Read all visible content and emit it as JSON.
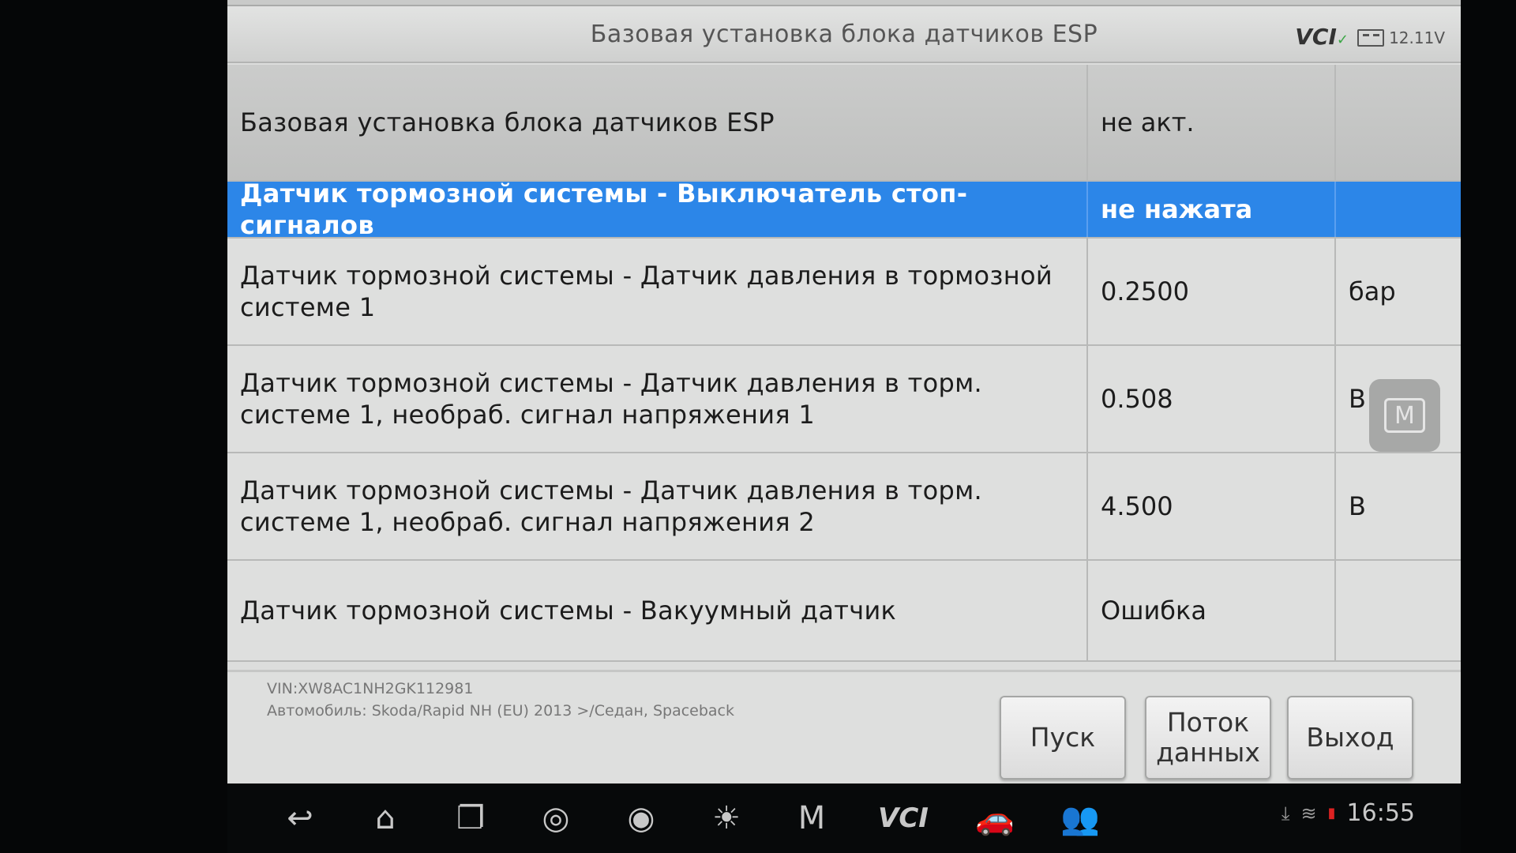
{
  "window": {
    "title": "Базовая установка блока датчиков ESP",
    "vci_label": "VCI",
    "voltage": "12.11V"
  },
  "table": {
    "rows": [
      {
        "name": "Базовая установка блока датчиков ESP",
        "value": "не акт.",
        "unit": ""
      },
      {
        "name": "Датчик тормозной системы - Выключатель стоп-сигналов",
        "value": "не нажата",
        "unit": ""
      },
      {
        "name": "Датчик тормозной системы - Датчик давления в тормозной системе 1",
        "value": "0.2500",
        "unit": "бар"
      },
      {
        "name": "Датчик тормозной системы - Датчик давления в торм. системе 1, необраб. сигнал напряжения 1",
        "value": "0.508",
        "unit": "В"
      },
      {
        "name": "Датчик тормозной системы - Датчик давления в торм. системе 1, необраб. сигнал напряжения 2",
        "value": "4.500",
        "unit": "В"
      },
      {
        "name": "Датчик тормозной системы - Вакуумный датчик",
        "value": "Ошибка",
        "unit": ""
      }
    ]
  },
  "side_button": {
    "label": "M"
  },
  "info": {
    "vin": "VIN:XW8AC1NH2GK112981",
    "vehicle": "Автомобиль: Skoda/Rapid NH (EU) 2013 >/Седан, Spaceback"
  },
  "buttons": {
    "start": "Пуск",
    "stream": "Поток данных",
    "exit": "Выход"
  },
  "navbar": {
    "icons": [
      "back-icon",
      "home-icon",
      "recent-apps-icon",
      "browser-icon",
      "camera-icon",
      "brightness-icon",
      "maxisys-home-icon",
      "vci-icon",
      "car-icon",
      "remote-support-icon"
    ],
    "vci_text": "VCI",
    "home_badge": "M",
    "clock": "16:55"
  },
  "colors": {
    "selected_row": "#2c86e8",
    "background": "#dcdddc"
  }
}
